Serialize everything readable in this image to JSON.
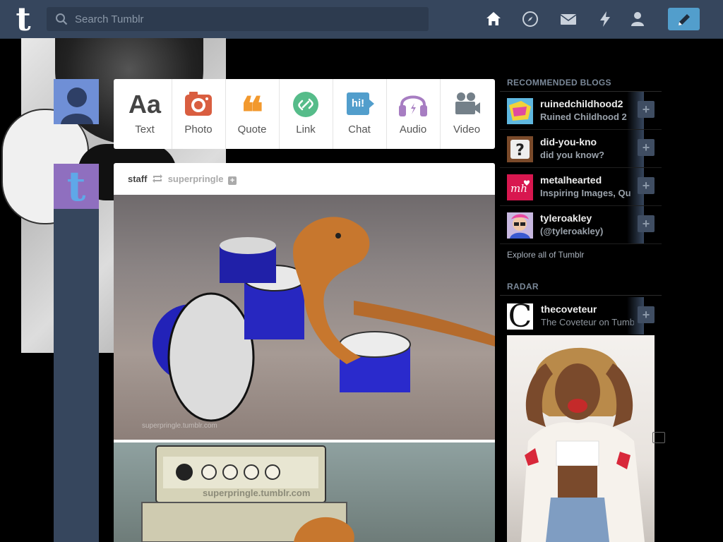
{
  "topbar": {
    "logo_letter": "t",
    "search_placeholder": "Search Tumblr",
    "nav_icons": [
      "home-icon",
      "explore-compass-icon",
      "inbox-mail-icon",
      "activity-lightning-icon",
      "account-person-icon"
    ],
    "compose_icon": "pencil-icon",
    "accent_color": "#529ecc",
    "bar_color": "#36465d"
  },
  "left_rail": {
    "avatar2_letter": "t"
  },
  "post_types": [
    {
      "label": "Text",
      "glyph": "Aa",
      "color": "#444444"
    },
    {
      "label": "Photo",
      "glyph": "camera",
      "color": "#d95e40"
    },
    {
      "label": "Quote",
      "glyph": "❝",
      "color": "#f2992e"
    },
    {
      "label": "Link",
      "glyph": "link",
      "color": "#56bc8a"
    },
    {
      "label": "Chat",
      "glyph": "hi!",
      "color": "#529ecc"
    },
    {
      "label": "Audio",
      "glyph": "headphones",
      "color": "#a77dc2"
    },
    {
      "label": "Video",
      "glyph": "video-camera",
      "color": "#748089"
    }
  ],
  "post": {
    "author": "staff",
    "reblogged_from": "superpringle",
    "image1_watermark": "superpringle.tumblr.com",
    "image2_watermark": "superpringle.tumblr.com"
  },
  "sidebar": {
    "recommended_title": "RECOMMENDED BLOGS",
    "recommended": [
      {
        "name": "ruinedchildhood2",
        "sub": "Ruined Childhood 2"
      },
      {
        "name": "did-you-kno",
        "sub": "did you know?"
      },
      {
        "name": "metalhearted",
        "sub": "Inspiring Images, Qu"
      },
      {
        "name": "tyleroakley",
        "sub": "(@tyleroakley)"
      }
    ],
    "explore_link": "Explore all of Tumblr",
    "radar_title": "RADAR",
    "radar": {
      "name": "thecoveteur",
      "sub": "The Coveteur on Tumb",
      "avatar_letter": "C"
    },
    "follow_symbol": "+"
  }
}
